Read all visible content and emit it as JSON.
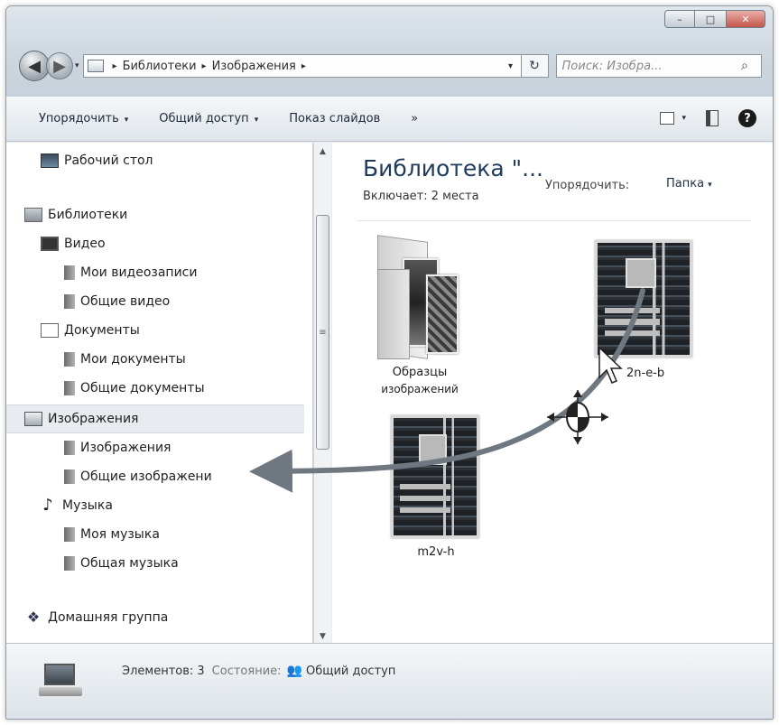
{
  "window": {
    "caption_buttons": [
      "–",
      "□",
      "✕"
    ]
  },
  "nav": {
    "back_icon": "◀",
    "forward_icon": "▶",
    "history_icon": "▾",
    "breadcrumb": [
      "Библиотеки",
      "Изображения"
    ],
    "crumb_separator": "▸",
    "address_dropdown_icon": "▾",
    "refresh_icon": "↻",
    "search_placeholder": "Поиск: Изобра...",
    "search_icon": "⌕"
  },
  "toolbar": {
    "organize": "Упорядочить",
    "share": "Общий доступ",
    "slideshow": "Показ слайдов",
    "more": "»",
    "dropdown_arrow": "▾",
    "help": "?"
  },
  "sidebar": {
    "items": [
      {
        "label": "Рабочий стол",
        "icon": "desktop-icon"
      },
      {
        "label": "Библиотеки",
        "icon": "library-icon"
      },
      {
        "label": "Видео",
        "icon": "video-library-icon"
      },
      {
        "label": "Мои видеозаписи",
        "icon": "folder-icon"
      },
      {
        "label": "Общие видео",
        "icon": "folder-icon"
      },
      {
        "label": "Документы",
        "icon": "documents-library-icon"
      },
      {
        "label": "Мои документы",
        "icon": "folder-icon"
      },
      {
        "label": "Общие документы",
        "icon": "folder-icon"
      },
      {
        "label": "Изображения",
        "icon": "pictures-library-icon"
      },
      {
        "label": "Изображения",
        "icon": "folder-icon"
      },
      {
        "label": "Общие изображени",
        "icon": "folder-icon"
      },
      {
        "label": "Музыка",
        "icon": "music-note-icon"
      },
      {
        "label": "Моя музыка",
        "icon": "folder-icon"
      },
      {
        "label": "Общая музыка",
        "icon": "folder-icon"
      },
      {
        "label": "Домашняя группа",
        "icon": "homegroup-icon"
      }
    ],
    "selected": "Изображения",
    "scroll_up": "▲",
    "scroll_down": "▼",
    "scroll_grip": "≡"
  },
  "content": {
    "title": "Библиотека \"...",
    "includes": "Включает: 2 места",
    "arrange_label": "Упорядочить:",
    "arrange_value": "Папка",
    "arrange_arrow": "▾",
    "files": [
      {
        "line1": "Образцы",
        "line2": "изображений"
      },
      {
        "line1": "2n-e-b"
      },
      {
        "line1": "m2v-h"
      }
    ]
  },
  "status": {
    "count": "Элементов: 3",
    "state_label": "Состояние:",
    "share_icon": "👥",
    "state_value": "Общий доступ"
  },
  "colors": {
    "title": "#1f3a5a",
    "drag_arrow": "#6f7880",
    "selection": "#e8ecf0"
  }
}
